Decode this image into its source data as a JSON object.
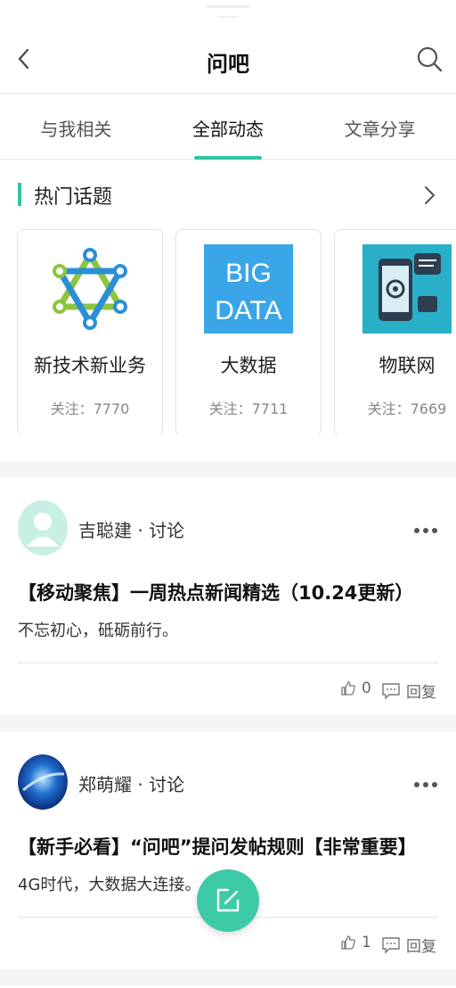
{
  "header": {
    "title": "问吧"
  },
  "tabs": [
    {
      "label": "与我相关"
    },
    {
      "label": "全部动态"
    },
    {
      "label": "文章分享"
    }
  ],
  "hot_topics": {
    "label": "热门话题",
    "items": [
      {
        "name": "新技术新业务",
        "follow": "关注：7770",
        "icon": "tech-star-icon"
      },
      {
        "name": "大数据",
        "follow": "关注：7711",
        "icon": "big-data-image",
        "image_text_1": "BIG",
        "image_text_2": "DATA"
      },
      {
        "name": "物联网",
        "follow": "关注：7669",
        "icon": "iot-phone-image"
      }
    ]
  },
  "posts": [
    {
      "author": "吉聪建 · 讨论",
      "title": "【移动聚焦】一周热点新闻精选（10.24更新）",
      "excerpt": "不忘初心，砥砺前行。",
      "likes": "0",
      "reply_label": "回复"
    },
    {
      "author": "郑萌耀 · 讨论",
      "title": "【新手必看】“问吧”提问发帖规则【非常重要】",
      "excerpt": "4G时代，大数据大连接。",
      "likes": "1",
      "reply_label": "回复"
    }
  ],
  "colors": {
    "accent": "#2fc4a3",
    "fab": "#3dcaa6"
  }
}
